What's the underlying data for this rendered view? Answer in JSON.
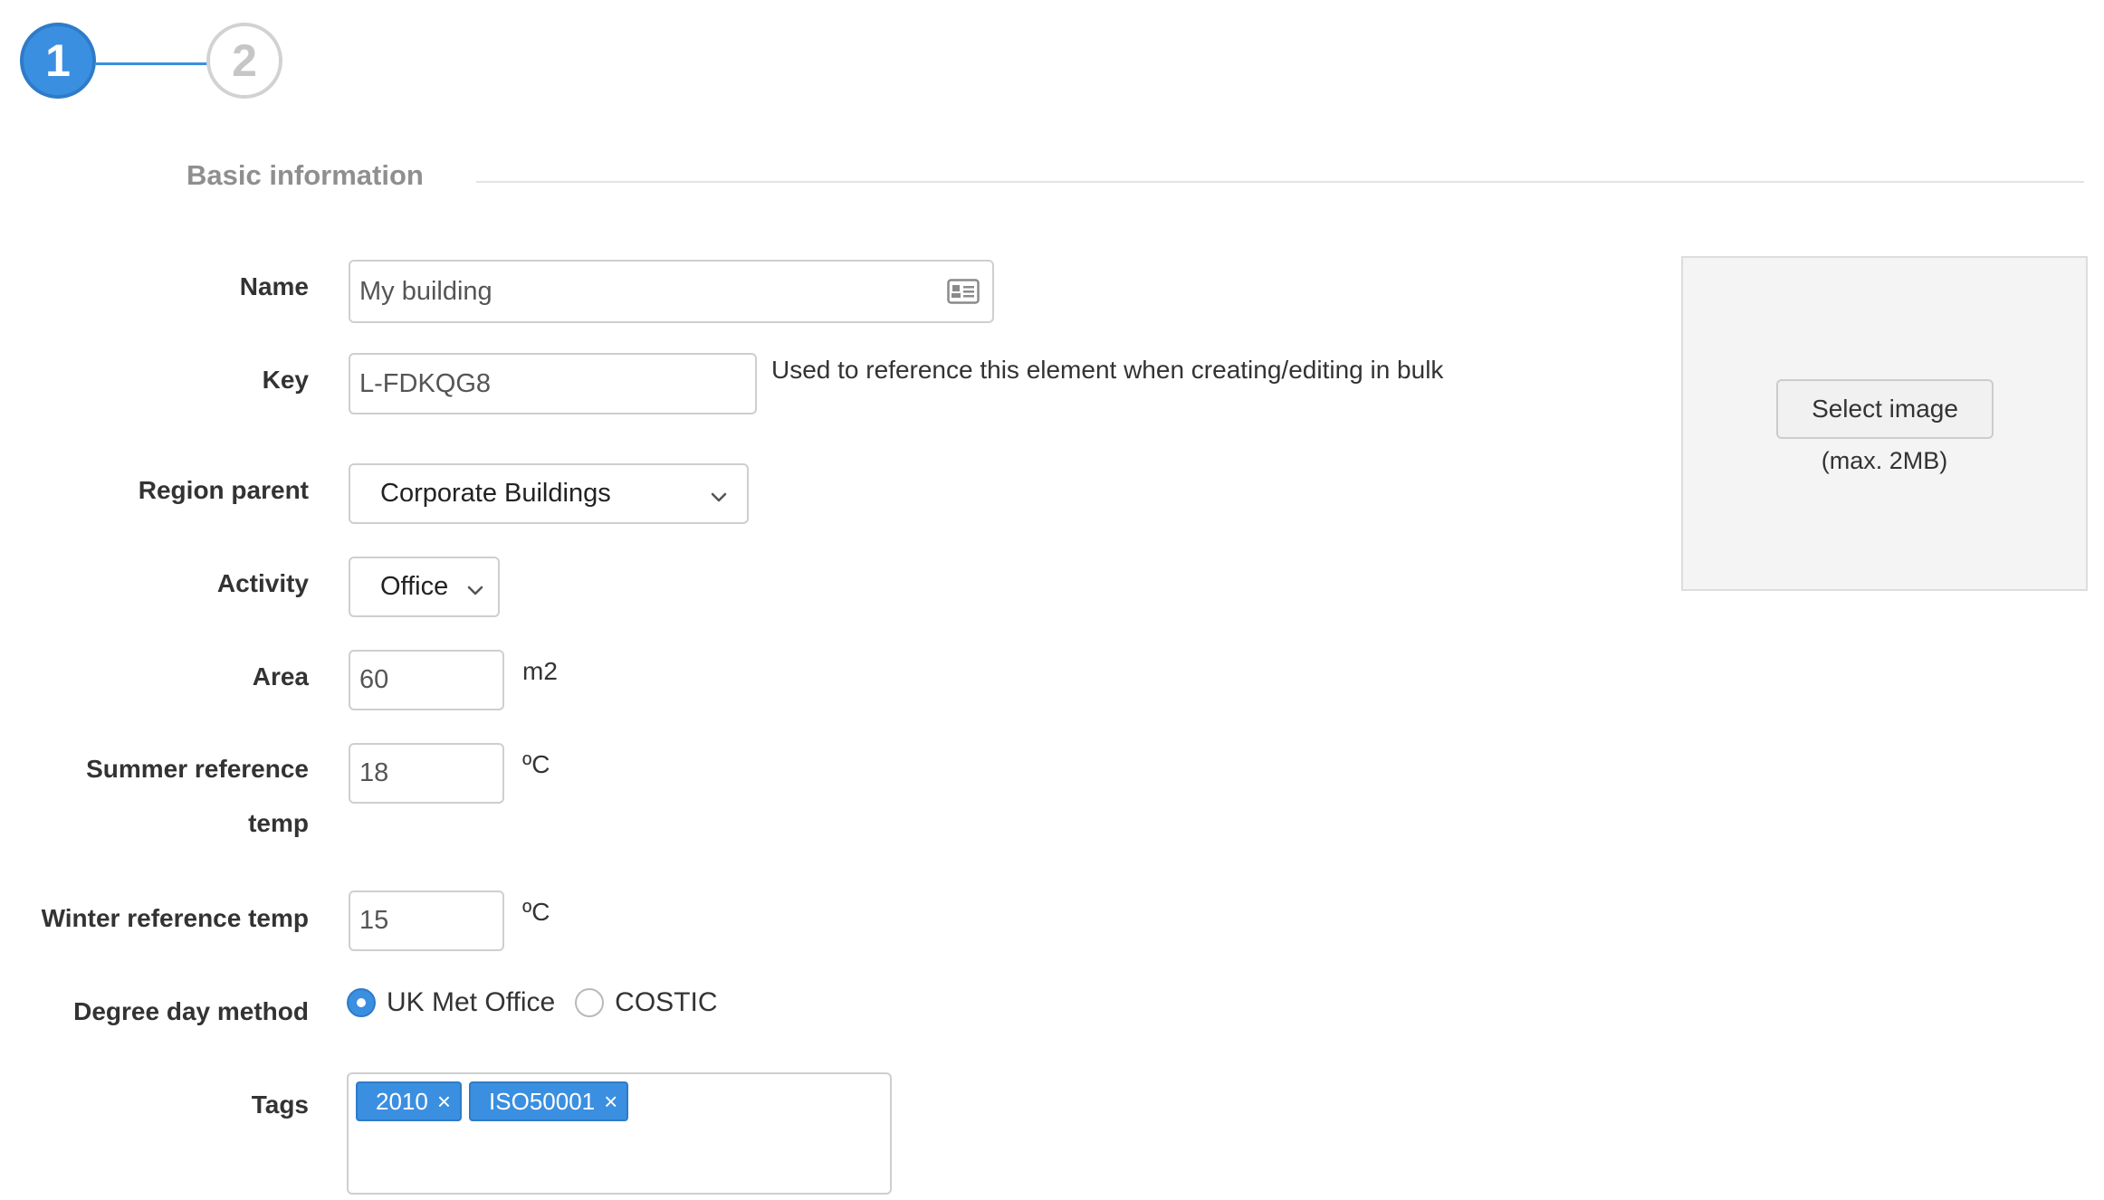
{
  "stepper": {
    "steps": [
      {
        "number": "1",
        "state": "active"
      },
      {
        "number": "2",
        "state": "inactive"
      }
    ]
  },
  "section": {
    "title": "Basic information"
  },
  "form": {
    "name": {
      "label": "Name",
      "value": "My building",
      "icon": "contact-card-icon"
    },
    "key": {
      "label": "Key",
      "value": "L-FDKQG8",
      "help": "Used to reference this element when creating/editing in bulk"
    },
    "region_parent": {
      "label": "Region parent",
      "value": "Corporate Buildings"
    },
    "activity": {
      "label": "Activity",
      "value": "Office"
    },
    "area": {
      "label": "Area",
      "value": "60",
      "unit": "m2"
    },
    "summer_temp": {
      "label": "Summer reference temp",
      "value": "18",
      "unit": "ºC"
    },
    "winter_temp": {
      "label": "Winter reference temp",
      "value": "15",
      "unit": "ºC"
    },
    "degree_day_method": {
      "label": "Degree day method",
      "options": [
        {
          "label": "UK Met Office",
          "selected": true
        },
        {
          "label": "COSTIC",
          "selected": false
        }
      ]
    },
    "tags": {
      "label": "Tags",
      "items": [
        "2010",
        "ISO50001"
      ],
      "remove_glyph": "×"
    }
  },
  "image_upload": {
    "button_label": "Select image",
    "note": "(max. 2MB)"
  },
  "colors": {
    "accent": "#3b8fe0",
    "inactive_step": "#c6c6c6",
    "section_title": "#8f8f8f"
  }
}
